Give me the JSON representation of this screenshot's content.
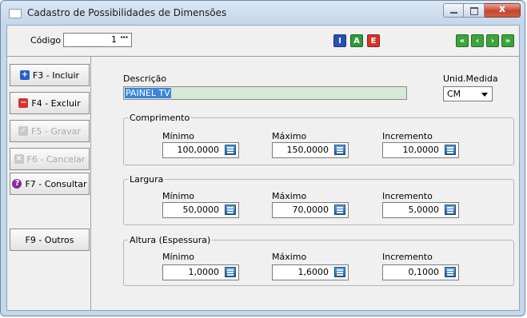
{
  "window": {
    "title": "Cadastro de Possibilidades de Dimensões"
  },
  "toolbar": {
    "codigo_label": "Código",
    "codigo_value": "1",
    "codigo_lookup": "···",
    "mode_buttons": [
      {
        "glyph": "I",
        "color": "#2a4fb8"
      },
      {
        "glyph": "A",
        "color": "#2f9a3a"
      },
      {
        "glyph": "E",
        "color": "#d5342a"
      }
    ],
    "nav_buttons": [
      {
        "glyph": "«",
        "color": "#39a53a"
      },
      {
        "glyph": "‹",
        "color": "#39a53a"
      },
      {
        "glyph": "›",
        "color": "#39a53a"
      },
      {
        "glyph": "»",
        "color": "#39a53a"
      }
    ]
  },
  "sidebar": {
    "buttons": [
      {
        "label": "F3 - Incluir",
        "icon": "plus-icon",
        "glyph": "+",
        "color": "#2a5fc4",
        "enabled": true
      },
      {
        "label": "F4 - Excluir",
        "icon": "minus-icon",
        "glyph": "−",
        "color": "#d8322b",
        "enabled": true
      },
      {
        "label": "F5 - Gravar",
        "icon": "check-icon",
        "glyph": "✓",
        "color": "#c9c9c9",
        "enabled": false
      },
      {
        "label": "F6 - Cancelar",
        "icon": "x-icon",
        "glyph": "×",
        "color": "#c9c9c9",
        "enabled": false
      },
      {
        "label": "F7 - Consultar",
        "icon": "question-icon",
        "glyph": "?",
        "color": "#8a2b96",
        "enabled": true
      },
      {
        "label": "F9 - Outros",
        "enabled": true
      }
    ]
  },
  "form": {
    "descricao_label": "Descrição",
    "descricao_value": "PAINEL TV",
    "unid_label": "Unid.Medida",
    "unid_value": "CM",
    "groups": [
      {
        "title": "Comprimento",
        "labels": [
          "Mínimo",
          "Máximo",
          "Incremento"
        ],
        "values": [
          "100,0000",
          "150,0000",
          "10,0000"
        ]
      },
      {
        "title": "Largura",
        "labels": [
          "Mínimo",
          "Máximo",
          "Incremento"
        ],
        "values": [
          "50,0000",
          "70,0000",
          "5,0000"
        ]
      },
      {
        "title": "Altura (Espessura)",
        "labels": [
          "Mínimo",
          "Máximo",
          "Incremento"
        ],
        "values": [
          "1,0000",
          "1,6000",
          "0,1000"
        ]
      }
    ]
  }
}
